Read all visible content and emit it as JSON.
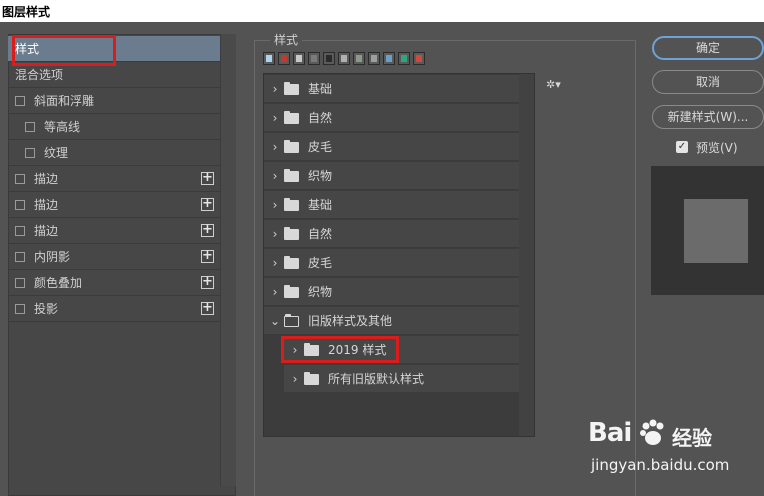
{
  "window": {
    "title": "图层样式"
  },
  "left_panel": {
    "items": [
      {
        "label": "样式",
        "checkbox": false,
        "plus": false,
        "selected": true
      },
      {
        "label": "混合选项",
        "checkbox": false,
        "plus": false
      },
      {
        "label": "斜面和浮雕",
        "checkbox": true,
        "plus": false
      },
      {
        "label": "等高线",
        "checkbox": true,
        "plus": false,
        "indent": true
      },
      {
        "label": "纹理",
        "checkbox": true,
        "plus": false,
        "indent": true
      },
      {
        "label": "描边",
        "checkbox": true,
        "plus": true
      },
      {
        "label": "描边",
        "checkbox": true,
        "plus": true
      },
      {
        "label": "描边",
        "checkbox": true,
        "plus": true
      },
      {
        "label": "内阴影",
        "checkbox": true,
        "plus": true
      },
      {
        "label": "颜色叠加",
        "checkbox": true,
        "plus": true
      },
      {
        "label": "投影",
        "checkbox": true,
        "plus": true
      }
    ]
  },
  "styles_group": {
    "label": "样式",
    "swatches": [
      "#aad4f0",
      "#c0392b",
      "#c8c8c8",
      "#7a7a7a",
      "#2b2b2b",
      "#b0b0b0",
      "#8a9a8a",
      "#9aa0a0",
      "#6aa0c8",
      "#2aa87a",
      "#d04a3a"
    ],
    "tree": [
      {
        "label": "基础",
        "expanded": false
      },
      {
        "label": "自然",
        "expanded": false
      },
      {
        "label": "皮毛",
        "expanded": false
      },
      {
        "label": "织物",
        "expanded": false
      },
      {
        "label": "基础",
        "expanded": false
      },
      {
        "label": "自然",
        "expanded": false
      },
      {
        "label": "皮毛",
        "expanded": false
      },
      {
        "label": "织物",
        "expanded": false
      },
      {
        "label": "旧版样式及其他",
        "expanded": true
      },
      {
        "label": "2019 样式",
        "expanded": false,
        "child": true
      },
      {
        "label": "所有旧版默认样式",
        "expanded": false,
        "child": true
      }
    ],
    "gear_icon": "gear-icon"
  },
  "buttons": {
    "ok": "确定",
    "cancel": "取消",
    "new_style": "新建样式(W)..."
  },
  "preview": {
    "label": "预览(V)",
    "checked": true
  },
  "watermark": {
    "logo": "Bai",
    "logo_suffix": "经验",
    "url": "jingyan.baidu.com"
  }
}
